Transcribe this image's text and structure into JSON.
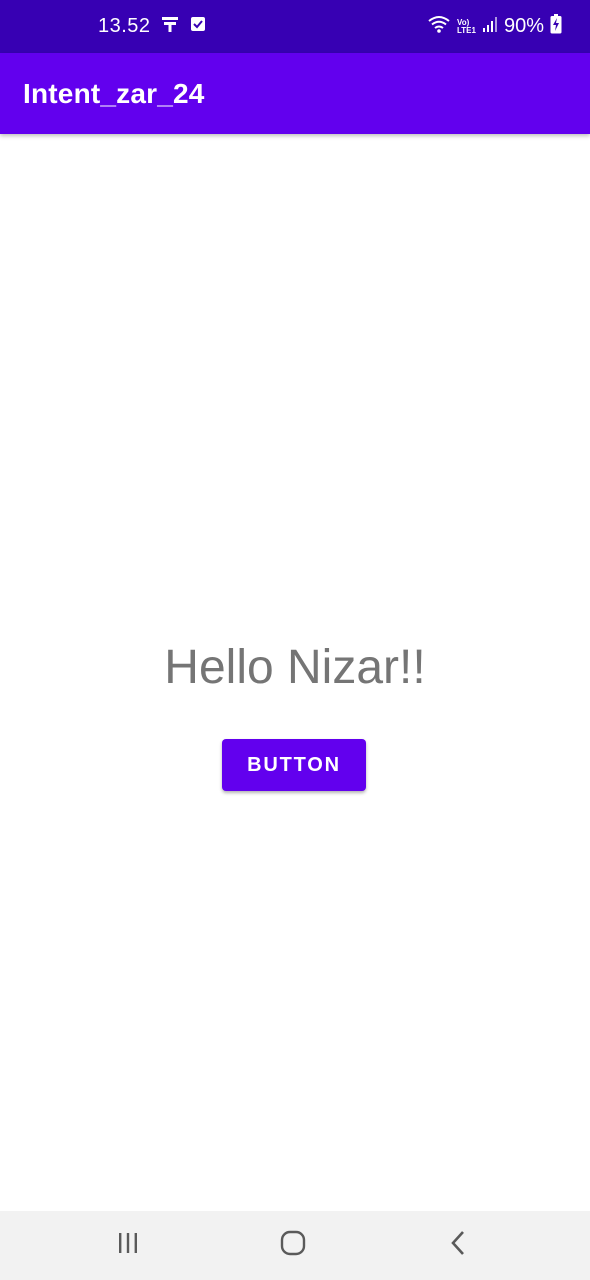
{
  "status_bar": {
    "time": "13.52",
    "volte_top": "Vo)",
    "volte_bottom": "LTE1",
    "battery_percent": "90%",
    "icons": [
      "notification-tool-icon",
      "check-box-icon",
      "wifi-icon",
      "volte-icon",
      "signal-icon",
      "battery-charging-icon"
    ]
  },
  "app_bar": {
    "title": "Intent_zar_24"
  },
  "main": {
    "greeting": "Hello Nizar!!",
    "button_label": "BUTTON"
  },
  "nav_bar": {
    "icons": [
      "recent-apps-icon",
      "home-icon",
      "back-icon"
    ]
  },
  "colors": {
    "status_bar": "#3700b3",
    "primary": "#6200ee",
    "text_gray": "#757575",
    "nav_bg": "#f2f2f2"
  }
}
